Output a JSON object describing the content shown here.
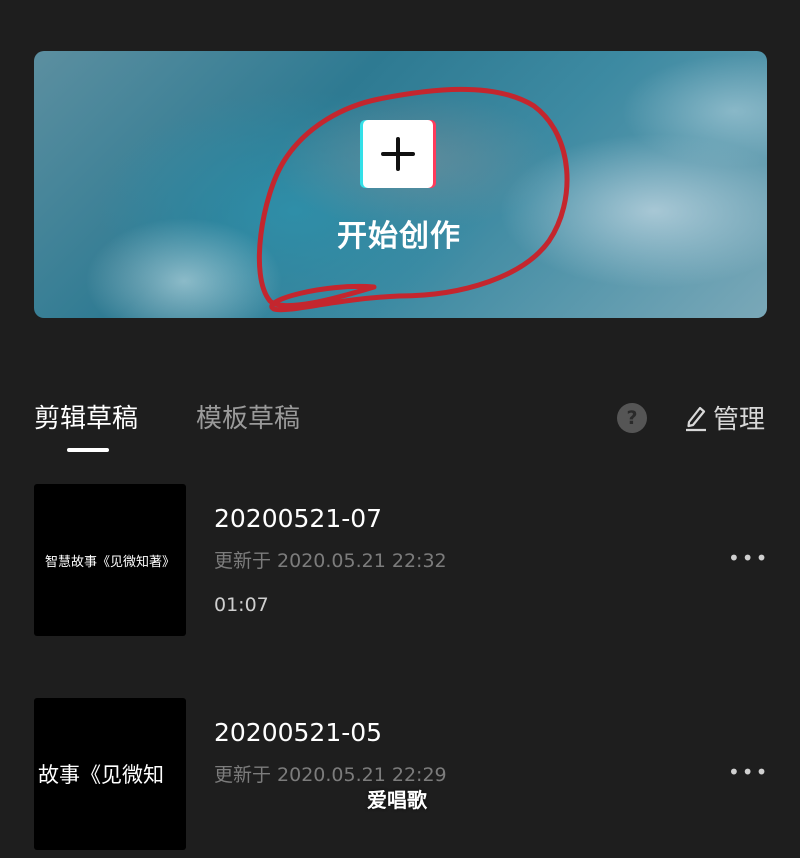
{
  "banner": {
    "create_label": "开始创作",
    "plus_icon": "plus-icon"
  },
  "tabs": [
    {
      "label": "剪辑草稿",
      "active": true
    },
    {
      "label": "模板草稿",
      "active": false
    }
  ],
  "toolbar": {
    "help_symbol": "?",
    "manage_label": "管理",
    "manage_icon": "edit-icon"
  },
  "projects": [
    {
      "thumbnail_text": "智慧故事《见微知著》",
      "title": "20200521-07",
      "updated": "更新于 2020.05.21 22:32",
      "duration": "01:07",
      "more": "•••"
    },
    {
      "thumbnail_text": "故事《见微知",
      "title": "20200521-05",
      "updated": "更新于 2020.05.21 22:29",
      "duration": "",
      "more": "•••"
    }
  ],
  "watermark": "爱唱歌",
  "colors": {
    "background": "#1e1e1e",
    "annotation_red": "#c4262e",
    "accent_cyan": "#33e0e8",
    "accent_pink": "#ff3b5c"
  }
}
